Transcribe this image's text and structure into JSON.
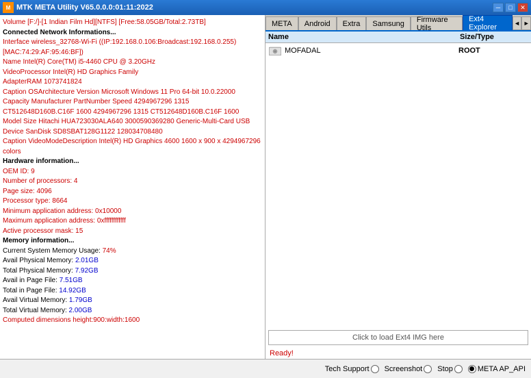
{
  "titleBar": {
    "title": "MTK META Utility V65.0.0.0:01:11:2022",
    "minBtn": "─",
    "maxBtn": "□",
    "closeBtn": "✕"
  },
  "tabs": [
    {
      "label": "META",
      "active": false
    },
    {
      "label": "Android",
      "active": false
    },
    {
      "label": "Extra",
      "active": false
    },
    {
      "label": "Samsung",
      "active": false
    },
    {
      "label": "Firmware Utils",
      "active": false
    },
    {
      "label": "Ext4 Explorer",
      "active": true
    }
  ],
  "fileListHeader": {
    "nameCol": "Name",
    "sizeCol": "Size/Type"
  },
  "fileEntry": {
    "name": "MOFADAL",
    "type": "ROOT",
    "icon": "💾"
  },
  "dropZone": {
    "text": "Click to load Ext4 IMG here"
  },
  "rightStatus": {
    "text": "Ready!"
  },
  "leftPanel": {
    "lines": [
      {
        "type": "red",
        "text": "Volume [F:/]-[1 Indian Film Hd][NTFS] [Free:58.05GB/Total:2.73TB]"
      },
      {
        "type": "bold",
        "text": "Connected Network Informations..."
      },
      {
        "type": "red",
        "text": "Interface wireless_32768-Wi-Fi ((IP:192.168.0.106:Broadcast:192.168.0.255)[MAC:74:29:AF:95:46:BF])"
      },
      {
        "type": "red",
        "text": "Name Intel(R) Core(TM) i5-4460 CPU @ 3.20GHz"
      },
      {
        "type": "red",
        "text": "VideoProcessor Intel(R) HD Graphics Family"
      },
      {
        "type": "red",
        "text": "AdapterRAM 1073741824"
      },
      {
        "type": "red",
        "text": "Caption OSArchitecture Version Microsoft Windows 11 Pro 64-bit 10.0.22000"
      },
      {
        "type": "red",
        "text": "Capacity Manufacturer PartNumber Speed 4294967296 1315 CT512648D160B.C16F 1600 4294967296 1315 CT512648D160B.C16F 1600"
      },
      {
        "type": "red",
        "text": "Model Size Hitachi HUA723030ALA640 3000590369280 Generic-Multi-Card USB Device SanDisk SD8SBAT128G1122 128034708480"
      },
      {
        "type": "red",
        "text": "Caption VideoModeDescription Intel(R) HD Graphics 4600 1600 x 900 x 4294967296 colors"
      },
      {
        "type": "bold",
        "text": "Hardware information..."
      },
      {
        "type": "red",
        "text": "OEM ID: 9"
      },
      {
        "type": "red",
        "text": "Number of processors: 4"
      },
      {
        "type": "red",
        "text": "Page size: 4096"
      },
      {
        "type": "red",
        "text": "Processor type: 8664"
      },
      {
        "type": "red",
        "text": "Minimum application address: 0x10000"
      },
      {
        "type": "red",
        "text": "Maximum application address: 0xffffffffffff"
      },
      {
        "type": "red",
        "text": "Active processor mask: 15"
      },
      {
        "type": "bold",
        "text": "Memory information..."
      },
      {
        "type": "mem",
        "label": "Current System Memory Usage: ",
        "value": "74%",
        "valueColor": "red"
      },
      {
        "type": "mem",
        "label": "Avail Physical Memory: ",
        "value": "2.01GB",
        "valueColor": "blue"
      },
      {
        "type": "mem",
        "label": "Total Physical Memory: ",
        "value": "7.92GB",
        "valueColor": "blue"
      },
      {
        "type": "mem",
        "label": "Avail in Page File: ",
        "value": "7.51GB",
        "valueColor": "blue"
      },
      {
        "type": "mem",
        "label": "Total in Page File: ",
        "value": "14.92GB",
        "valueColor": "blue"
      },
      {
        "type": "mem",
        "label": "Avail Virtual Memory: ",
        "value": "1.79GB",
        "valueColor": "blue"
      },
      {
        "type": "mem",
        "label": "Total Virtual Memory: ",
        "value": "2.00GB",
        "valueColor": "blue"
      },
      {
        "type": "red",
        "text": "Computed dimensions height:900:width:1600"
      }
    ]
  },
  "bottomBar": {
    "techSupportLabel": "Tech Support",
    "screenshotLabel": "Screenshot",
    "stopLabel": "Stop",
    "metaApiLabel": "META AP_API",
    "techSupportChecked": false,
    "screenshotChecked": false,
    "stopChecked": false,
    "metaApiChecked": true
  }
}
